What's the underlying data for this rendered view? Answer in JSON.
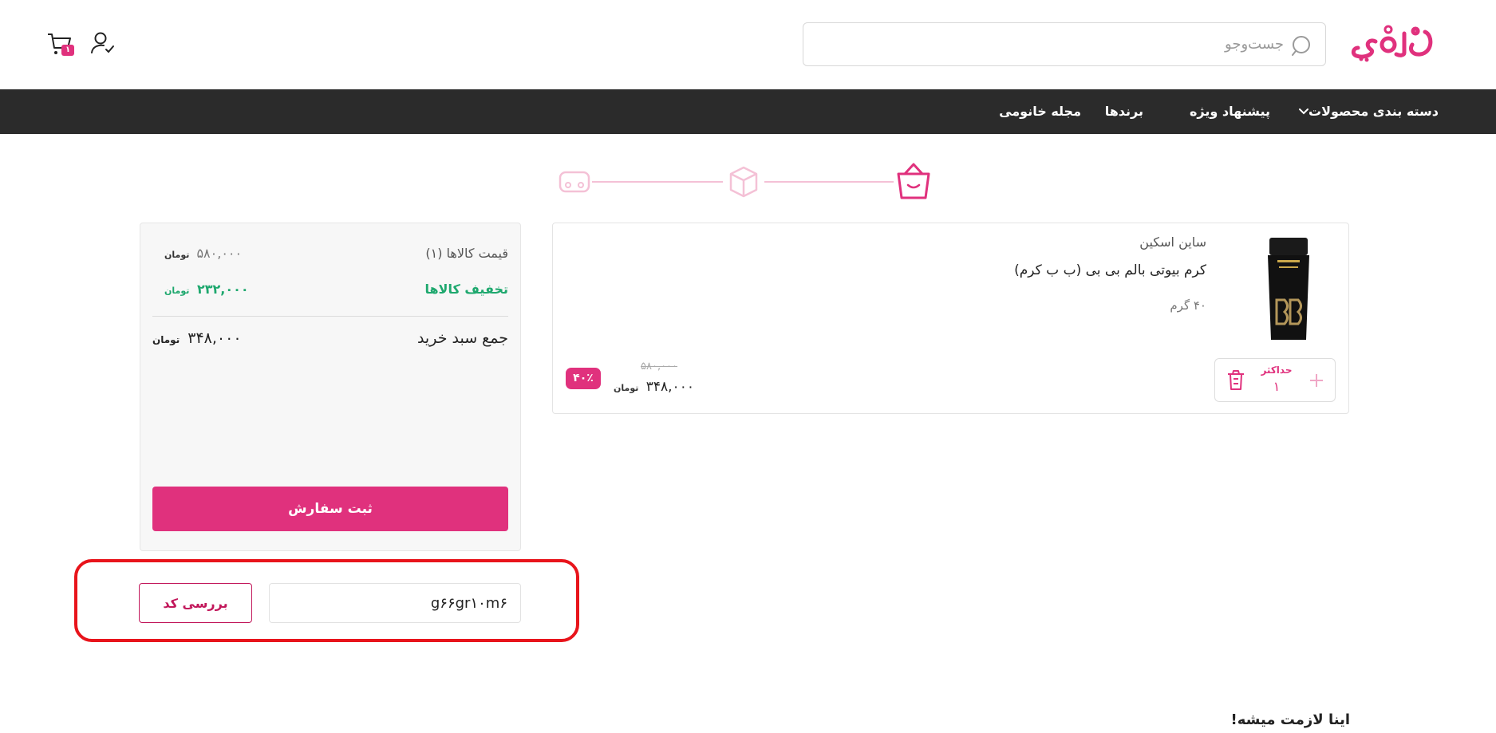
{
  "header": {
    "logo_text": "خانومی",
    "search_placeholder": "جست‌وجو",
    "cart_count": "۱"
  },
  "nav": {
    "items": [
      {
        "label": "دسته بندی محصولات"
      },
      {
        "label": "پیشنهاد ویژه"
      },
      {
        "label": "برندها"
      },
      {
        "label": "مجله خانومی"
      }
    ]
  },
  "cart_item": {
    "brand": "ساین اسکین",
    "name": "کرم بیوتی بالم بی بی (ب ب کرم)",
    "weight": "۴۰ گرم",
    "quantity_max_label": "حداکثر",
    "quantity": "۱",
    "old_price": "۵۸۰,۰۰۰",
    "price": "۳۴۸,۰۰۰",
    "currency": "تومان",
    "discount": "۴۰٪"
  },
  "summary": {
    "items_price_label": "قیمت کالاها (۱)",
    "items_price_value": "۵۸۰,۰۰۰",
    "discount_label": "تخفیف کالاها",
    "discount_value": "۲۳۲,۰۰۰",
    "total_label": "جمع سبد خرید",
    "total_value": "۳۴۸,۰۰۰",
    "currency": "تومان",
    "submit_label": "ثبت سفارش"
  },
  "coupon": {
    "value": "g۶۶gr۱۰m۶",
    "check_label": "بررسی کد"
  },
  "footer": {
    "heading": "اینا لازمت میشه!"
  },
  "colors": {
    "brand_pink": "#e0317d",
    "nav_bg": "#2b2b2b",
    "discount_green": "#1ea86e",
    "highlight_red": "#e8141b"
  }
}
